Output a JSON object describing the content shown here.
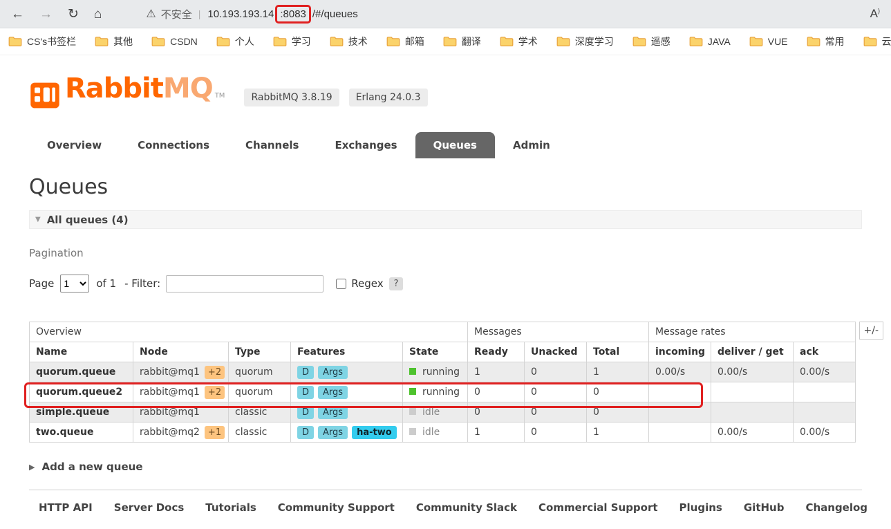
{
  "colors": {
    "accent-orange": "#ff6600",
    "logo-mq": "#f9a871",
    "tab-active-bg": "#666666",
    "feature-badge": "#7fd4e4",
    "feature-badge-strong": "#33ccee",
    "node-badge": "#fdc47f",
    "state-running": "#4ec22e",
    "state-idle": "#cccccc",
    "annotation-red": "#e02020"
  },
  "browser": {
    "icons": {
      "back": "←",
      "forward": "→",
      "reload": "↻",
      "home": "⌂",
      "warning": "⚠",
      "read_aloud": "A",
      "read_aloud_wave": ")"
    },
    "security_label": "不安全",
    "separator": "|",
    "url_host": "10.193.193.14",
    "url_port": ":8083",
    "url_path": "/#/queues",
    "bookmarks": [
      "CS's书签栏",
      "其他",
      "CSDN",
      "个人",
      "学习",
      "技术",
      "邮箱",
      "翻译",
      "学术",
      "深度学习",
      "遥感",
      "JAVA",
      "VUE",
      "常用",
      "云服务"
    ]
  },
  "app": {
    "icons": {
      "collapse": "▼",
      "expand": "▶"
    },
    "logo": {
      "text_primary": "Rabbit",
      "text_secondary": "MQ",
      "tm": "TM"
    },
    "version_badges": [
      "RabbitMQ 3.8.19",
      "Erlang 24.0.3"
    ],
    "tabs": [
      {
        "label": "Overview",
        "active": false
      },
      {
        "label": "Connections",
        "active": false
      },
      {
        "label": "Channels",
        "active": false
      },
      {
        "label": "Exchanges",
        "active": false
      },
      {
        "label": "Queues",
        "active": true
      },
      {
        "label": "Admin",
        "active": false
      }
    ],
    "page_title": "Queues",
    "all_queues_label": "All queues (4)",
    "pagination": {
      "label": "Pagination",
      "page_label": "Page",
      "page_value": "1",
      "of_label": "of 1",
      "filter_label": "- Filter:",
      "filter_value": "",
      "regex_label": "Regex",
      "help": "?"
    },
    "table": {
      "groups": [
        "Overview",
        "Messages",
        "Message rates"
      ],
      "plus_minus": "+/-",
      "columns": [
        "Name",
        "Node",
        "Type",
        "Features",
        "State",
        "Ready",
        "Unacked",
        "Total",
        "incoming",
        "deliver / get",
        "ack"
      ],
      "rows": [
        {
          "name": "quorum.queue",
          "node": "rabbit@mq1",
          "node_badge": "+2",
          "type": "quorum",
          "features": [
            {
              "label": "D"
            },
            {
              "label": "Args"
            }
          ],
          "state": "running",
          "ready": "1",
          "unacked": "0",
          "total": "1",
          "incoming": "0.00/s",
          "deliver": "0.00/s",
          "ack": "0.00/s"
        },
        {
          "name": "quorum.queue2",
          "node": "rabbit@mq1",
          "node_badge": "+2",
          "type": "quorum",
          "features": [
            {
              "label": "D"
            },
            {
              "label": "Args"
            }
          ],
          "state": "running",
          "ready": "0",
          "unacked": "0",
          "total": "0",
          "incoming": "",
          "deliver": "",
          "ack": ""
        },
        {
          "name": "simple.queue",
          "node": "rabbit@mq1",
          "node_badge": "",
          "type": "classic",
          "features": [
            {
              "label": "D"
            },
            {
              "label": "Args"
            }
          ],
          "state": "idle",
          "ready": "0",
          "unacked": "0",
          "total": "0",
          "incoming": "",
          "deliver": "",
          "ack": ""
        },
        {
          "name": "two.queue",
          "node": "rabbit@mq2",
          "node_badge": "+1",
          "type": "classic",
          "features": [
            {
              "label": "D"
            },
            {
              "label": "Args"
            },
            {
              "label": "ha-two",
              "strong": true
            }
          ],
          "state": "idle",
          "ready": "1",
          "unacked": "0",
          "total": "1",
          "incoming": "",
          "deliver": "0.00/s",
          "ack": "0.00/s"
        }
      ]
    },
    "add_queue_label": "Add a new queue",
    "footer_links": [
      "HTTP API",
      "Server Docs",
      "Tutorials",
      "Community Support",
      "Community Slack",
      "Commercial Support",
      "Plugins",
      "GitHub",
      "Changelog"
    ]
  },
  "annotations": {
    "url_box_target": ":8083",
    "row_box_target": "quorum.queue2"
  }
}
